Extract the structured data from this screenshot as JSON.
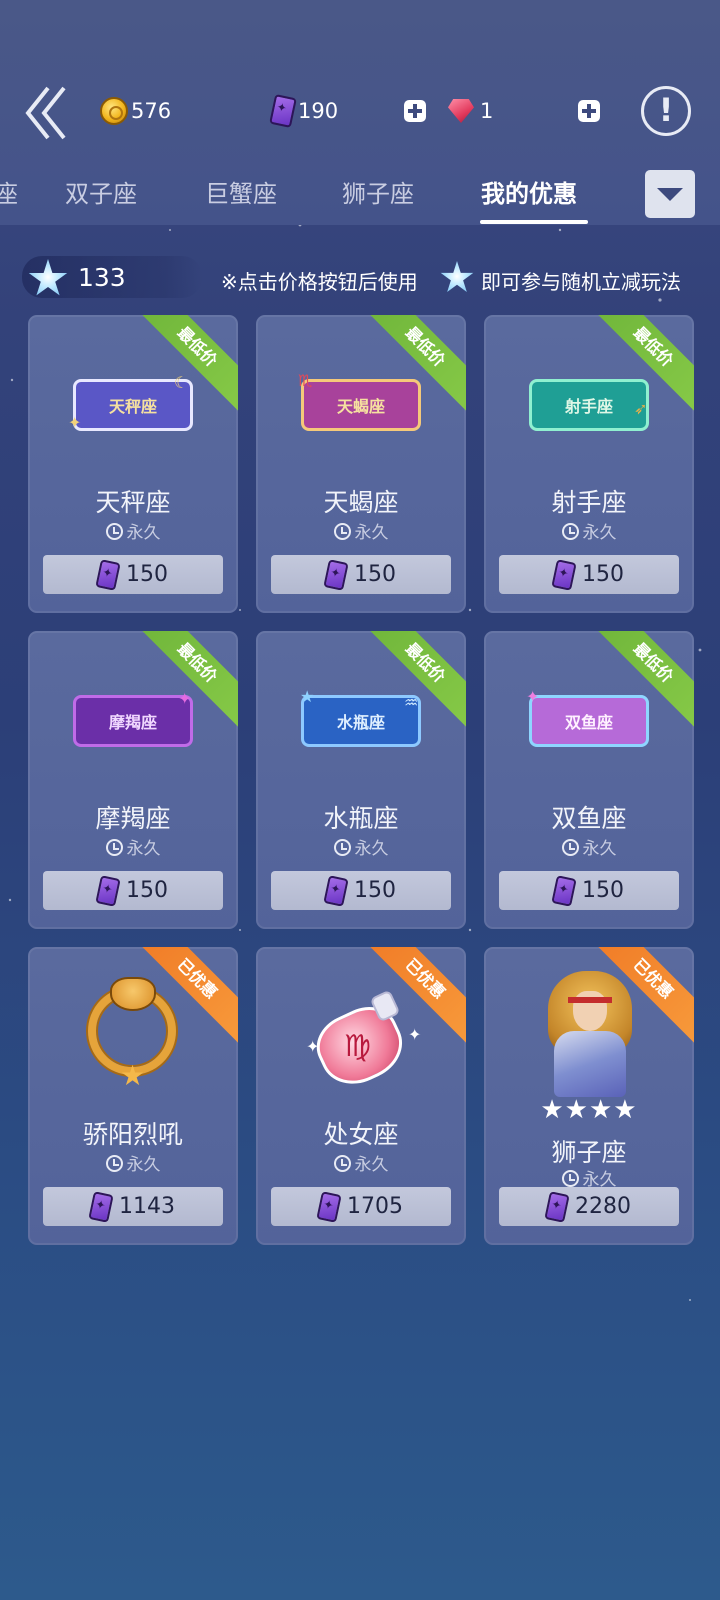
{
  "header": {
    "currencies": [
      {
        "name": "coin",
        "value": "576"
      },
      {
        "name": "card",
        "value": "190"
      },
      {
        "name": "gem",
        "value": "1"
      }
    ]
  },
  "tabs": [
    {
      "label": "座",
      "active": false
    },
    {
      "label": "双子座",
      "active": false
    },
    {
      "label": "巨蟹座",
      "active": false
    },
    {
      "label": "狮子座",
      "active": false
    },
    {
      "label": "我的优惠",
      "active": true
    }
  ],
  "info": {
    "star_count": "133",
    "hint_part1": "※点击价格按钮后使用",
    "hint_part2": "即可参与随机立减玩法"
  },
  "items": [
    {
      "name": "天秤座",
      "frame_text": "天秤座",
      "duration": "永久",
      "price": "150",
      "ribbon": "最低价",
      "ribbon_color": "#7cc043",
      "frame_bg": "#5a57c6"
    },
    {
      "name": "天蝎座",
      "frame_text": "天蝎座",
      "duration": "永久",
      "price": "150",
      "ribbon": "最低价",
      "ribbon_color": "#7cc043",
      "frame_bg": "#a8429b"
    },
    {
      "name": "射手座",
      "frame_text": "射手座",
      "duration": "永久",
      "price": "150",
      "ribbon": "最低价",
      "ribbon_color": "#7cc043",
      "frame_bg": "#1f9f95"
    },
    {
      "name": "摩羯座",
      "frame_text": "摩羯座",
      "duration": "永久",
      "price": "150",
      "ribbon": "最低价",
      "ribbon_color": "#7cc043",
      "frame_bg": "#6b2fa8"
    },
    {
      "name": "水瓶座",
      "frame_text": "水瓶座",
      "duration": "永久",
      "price": "150",
      "ribbon": "最低价",
      "ribbon_color": "#7cc043",
      "frame_bg": "#2a63c4"
    },
    {
      "name": "双鱼座",
      "frame_text": "双鱼座",
      "duration": "永久",
      "price": "150",
      "ribbon": "最低价",
      "ribbon_color": "#7cc043",
      "frame_bg": "#b66ad8"
    },
    {
      "name": "骄阳烈吼",
      "duration": "永久",
      "price": "1143",
      "ribbon": "已优惠",
      "ribbon_color": "#f28a30"
    },
    {
      "name": "处女座",
      "duration": "永久",
      "price": "1705",
      "ribbon": "已优惠",
      "ribbon_color": "#f28a30"
    },
    {
      "name": "狮子座",
      "duration": "永久",
      "price": "2280",
      "ribbon": "已优惠",
      "ribbon_color": "#f28a30",
      "stars": "★★★★"
    }
  ]
}
